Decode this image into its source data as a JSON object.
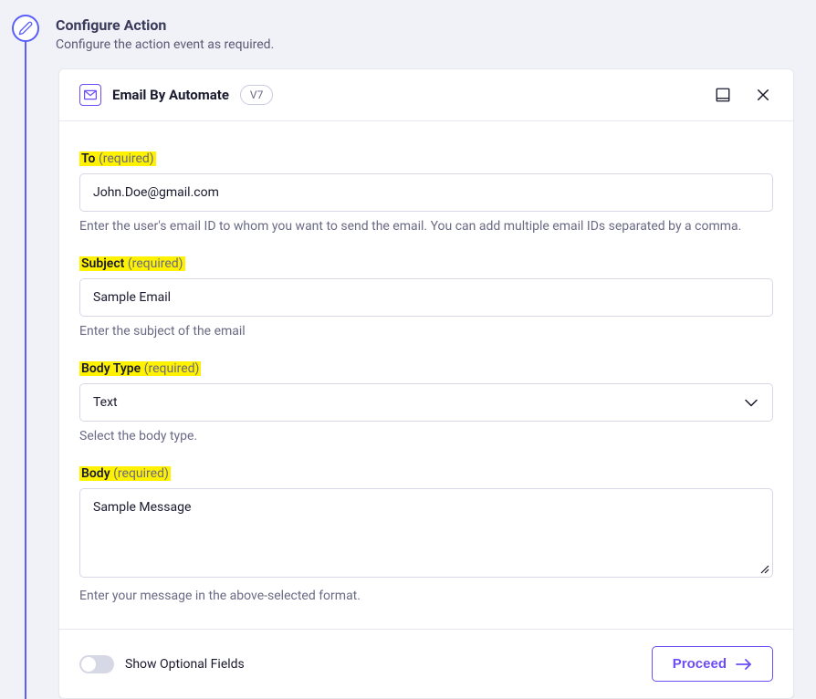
{
  "step": {
    "title": "Configure Action",
    "subtitle": "Configure the action event as required."
  },
  "card": {
    "appName": "Email By Automate",
    "version": "V7"
  },
  "fields": {
    "to": {
      "label": "To",
      "required": "(required)",
      "value": "John.Doe@gmail.com",
      "help": "Enter the user's email ID to whom you want to send the email. You can add multiple email IDs separated by a comma."
    },
    "subject": {
      "label": "Subject",
      "required": "(required)",
      "value": "Sample Email",
      "help": "Enter the subject of the email"
    },
    "bodyType": {
      "label": "Body Type",
      "required": "(required)",
      "value": "Text",
      "help": "Select the body type."
    },
    "body": {
      "label": "Body",
      "required": "(required)",
      "value": "Sample Message",
      "help": "Enter your message in the above-selected format."
    }
  },
  "footer": {
    "toggleLabel": "Show Optional Fields",
    "proceedLabel": "Proceed"
  }
}
